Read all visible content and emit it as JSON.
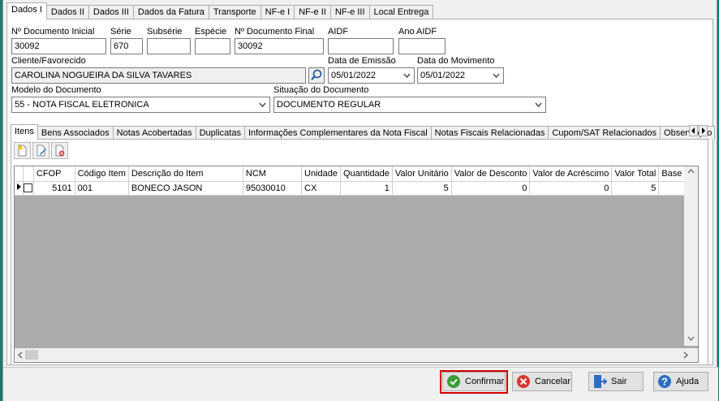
{
  "top_tabs": [
    "Dados I",
    "Dados II",
    "Dados III",
    "Dados da Fatura",
    "Transporte",
    "NF-e I",
    "NF-e II",
    "NF-e III",
    "Local Entrega"
  ],
  "fields": {
    "num_doc_inicial": {
      "label": "Nº Documento Inicial",
      "value": "30092"
    },
    "serie": {
      "label": "Série",
      "value": "670"
    },
    "subserie": {
      "label": "Subsérie",
      "value": ""
    },
    "especie": {
      "label": "Espécie",
      "value": ""
    },
    "num_doc_final": {
      "label": "Nº Documento Final",
      "value": "30092"
    },
    "aidf": {
      "label": "AIDF",
      "value": ""
    },
    "ano_aidf": {
      "label": "Ano AIDF",
      "value": ""
    },
    "cliente": {
      "label": "Cliente/Favorecido",
      "value": "CAROLINA NOGUEIRA DA SILVA TAVARES"
    },
    "data_emissao": {
      "label": "Data de Emissão",
      "value": "05/01/2022"
    },
    "data_movimento": {
      "label": "Data do Movimento",
      "value": "05/01/2022"
    },
    "modelo": {
      "label": "Modelo do Documento",
      "value": "55 - NOTA FISCAL ELETRONICA"
    },
    "situacao": {
      "label": "Situação do Documento",
      "value": "DOCUMENTO REGULAR"
    }
  },
  "inner_tabs": [
    "Itens",
    "Bens Associados",
    "Notas Acobertadas",
    "Duplicatas",
    "Informações Complementares da Nota Fiscal",
    "Notas Fiscais Relacionadas",
    "Cupom/SAT Relacionados",
    "Observação d"
  ],
  "grid": {
    "columns": [
      "CFOP",
      "Código Item",
      "Descrição do Item",
      "NCM",
      "Unidade",
      "Quantidade",
      "Valor Unitário",
      "Valor de Desconto",
      "Valor de Acréscimo",
      "Valor Total",
      "Base c"
    ],
    "rows": [
      {
        "cfop": "5101",
        "codigo": "001",
        "descricao": "BONECO JASON",
        "ncm": "95030010",
        "unidade": "CX",
        "quantidade": "1",
        "valor_unitario": "5",
        "desconto": "0",
        "acrescimo": "0",
        "total": "5",
        "base": ""
      }
    ]
  },
  "buttons": {
    "confirmar": "Confirmar",
    "cancelar": "Cancelar",
    "sair": "Sair",
    "ajuda": "Ajuda"
  },
  "icons": {
    "confirm": "green-check-icon",
    "cancel": "red-x-icon",
    "exit": "exit-door-icon",
    "help": "question-icon"
  },
  "colors": {
    "confirm_focus": "#d00000",
    "desktop": "#1b7a6e"
  }
}
